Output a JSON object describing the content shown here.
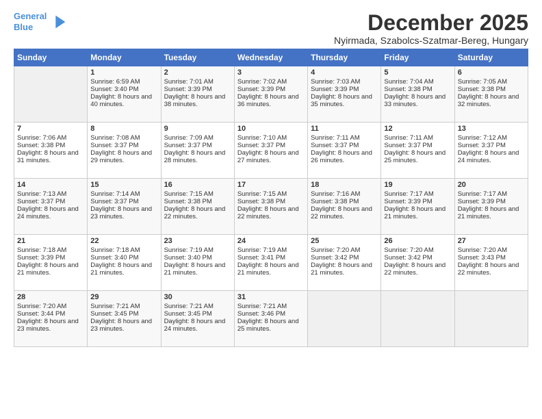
{
  "header": {
    "logo_line1": "General",
    "logo_line2": "Blue",
    "title": "December 2025",
    "location": "Nyirmada, Szabolcs-Szatmar-Bereg, Hungary"
  },
  "weekdays": [
    "Sunday",
    "Monday",
    "Tuesday",
    "Wednesday",
    "Thursday",
    "Friday",
    "Saturday"
  ],
  "weeks": [
    [
      {
        "day": "",
        "empty": true
      },
      {
        "day": "1",
        "sunrise": "6:59 AM",
        "sunset": "3:40 PM",
        "daylight": "8 hours and 40 minutes."
      },
      {
        "day": "2",
        "sunrise": "7:01 AM",
        "sunset": "3:39 PM",
        "daylight": "8 hours and 38 minutes."
      },
      {
        "day": "3",
        "sunrise": "7:02 AM",
        "sunset": "3:39 PM",
        "daylight": "8 hours and 36 minutes."
      },
      {
        "day": "4",
        "sunrise": "7:03 AM",
        "sunset": "3:39 PM",
        "daylight": "8 hours and 35 minutes."
      },
      {
        "day": "5",
        "sunrise": "7:04 AM",
        "sunset": "3:38 PM",
        "daylight": "8 hours and 33 minutes."
      },
      {
        "day": "6",
        "sunrise": "7:05 AM",
        "sunset": "3:38 PM",
        "daylight": "8 hours and 32 minutes."
      }
    ],
    [
      {
        "day": "7",
        "sunrise": "7:06 AM",
        "sunset": "3:38 PM",
        "daylight": "8 hours and 31 minutes."
      },
      {
        "day": "8",
        "sunrise": "7:08 AM",
        "sunset": "3:37 PM",
        "daylight": "8 hours and 29 minutes."
      },
      {
        "day": "9",
        "sunrise": "7:09 AM",
        "sunset": "3:37 PM",
        "daylight": "8 hours and 28 minutes."
      },
      {
        "day": "10",
        "sunrise": "7:10 AM",
        "sunset": "3:37 PM",
        "daylight": "8 hours and 27 minutes."
      },
      {
        "day": "11",
        "sunrise": "7:11 AM",
        "sunset": "3:37 PM",
        "daylight": "8 hours and 26 minutes."
      },
      {
        "day": "12",
        "sunrise": "7:11 AM",
        "sunset": "3:37 PM",
        "daylight": "8 hours and 25 minutes."
      },
      {
        "day": "13",
        "sunrise": "7:12 AM",
        "sunset": "3:37 PM",
        "daylight": "8 hours and 24 minutes."
      }
    ],
    [
      {
        "day": "14",
        "sunrise": "7:13 AM",
        "sunset": "3:37 PM",
        "daylight": "8 hours and 24 minutes."
      },
      {
        "day": "15",
        "sunrise": "7:14 AM",
        "sunset": "3:37 PM",
        "daylight": "8 hours and 23 minutes."
      },
      {
        "day": "16",
        "sunrise": "7:15 AM",
        "sunset": "3:38 PM",
        "daylight": "8 hours and 22 minutes."
      },
      {
        "day": "17",
        "sunrise": "7:15 AM",
        "sunset": "3:38 PM",
        "daylight": "8 hours and 22 minutes."
      },
      {
        "day": "18",
        "sunrise": "7:16 AM",
        "sunset": "3:38 PM",
        "daylight": "8 hours and 22 minutes."
      },
      {
        "day": "19",
        "sunrise": "7:17 AM",
        "sunset": "3:39 PM",
        "daylight": "8 hours and 21 minutes."
      },
      {
        "day": "20",
        "sunrise": "7:17 AM",
        "sunset": "3:39 PM",
        "daylight": "8 hours and 21 minutes."
      }
    ],
    [
      {
        "day": "21",
        "sunrise": "7:18 AM",
        "sunset": "3:39 PM",
        "daylight": "8 hours and 21 minutes."
      },
      {
        "day": "22",
        "sunrise": "7:18 AM",
        "sunset": "3:40 PM",
        "daylight": "8 hours and 21 minutes."
      },
      {
        "day": "23",
        "sunrise": "7:19 AM",
        "sunset": "3:40 PM",
        "daylight": "8 hours and 21 minutes."
      },
      {
        "day": "24",
        "sunrise": "7:19 AM",
        "sunset": "3:41 PM",
        "daylight": "8 hours and 21 minutes."
      },
      {
        "day": "25",
        "sunrise": "7:20 AM",
        "sunset": "3:42 PM",
        "daylight": "8 hours and 21 minutes."
      },
      {
        "day": "26",
        "sunrise": "7:20 AM",
        "sunset": "3:42 PM",
        "daylight": "8 hours and 22 minutes."
      },
      {
        "day": "27",
        "sunrise": "7:20 AM",
        "sunset": "3:43 PM",
        "daylight": "8 hours and 22 minutes."
      }
    ],
    [
      {
        "day": "28",
        "sunrise": "7:20 AM",
        "sunset": "3:44 PM",
        "daylight": "8 hours and 23 minutes."
      },
      {
        "day": "29",
        "sunrise": "7:21 AM",
        "sunset": "3:45 PM",
        "daylight": "8 hours and 23 minutes."
      },
      {
        "day": "30",
        "sunrise": "7:21 AM",
        "sunset": "3:45 PM",
        "daylight": "8 hours and 24 minutes."
      },
      {
        "day": "31",
        "sunrise": "7:21 AM",
        "sunset": "3:46 PM",
        "daylight": "8 hours and 25 minutes."
      },
      {
        "day": "",
        "empty": true
      },
      {
        "day": "",
        "empty": true
      },
      {
        "day": "",
        "empty": true
      }
    ]
  ]
}
